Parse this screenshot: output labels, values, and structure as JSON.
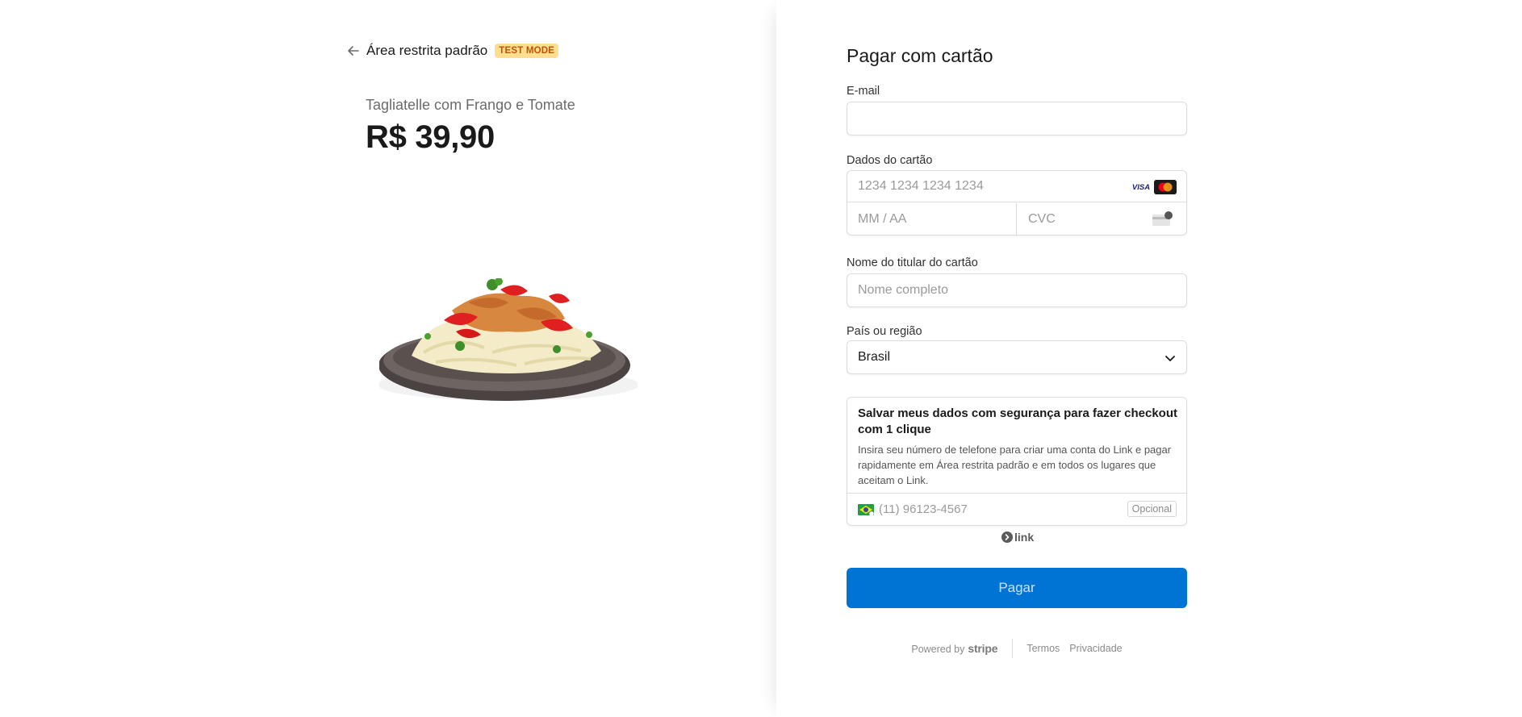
{
  "merchant": {
    "name": "Área restrita padrão",
    "badge": "TEST MODE"
  },
  "product": {
    "name": "Tagliatelle com Frango e Tomate",
    "price": "R$ 39,90"
  },
  "form": {
    "title": "Pagar com cartão",
    "email_label": "E-mail",
    "email_value": "",
    "card_label": "Dados do cartão",
    "card_number_placeholder": "1234 1234 1234 1234",
    "card_expiry_placeholder": "MM / AA",
    "card_cvc_placeholder": "CVC",
    "card_brands": [
      "VISA",
      "Mastercard"
    ],
    "name_label": "Nome do titular do cartão",
    "name_placeholder": "Nome completo",
    "country_label": "País ou região",
    "country_value": "Brasil"
  },
  "link": {
    "title": "Salvar meus dados com segurança para fazer checkout com 1 clique",
    "description": "Insira seu número de telefone para criar uma conta do Link e pagar rapidamente em Área restrita padrão e em todos os lugares que aceitam o Link.",
    "phone_placeholder": "(11) 96123-4567",
    "optional": "Opcional",
    "logo_text": "link"
  },
  "pay_button": "Pagar",
  "footer": {
    "powered_by": "Powered by",
    "brand": "stripe",
    "terms": "Termos",
    "privacy": "Privacidade"
  },
  "colors": {
    "accent": "#0074d4",
    "badge_bg": "#ffde92",
    "badge_text": "#bb5504"
  }
}
